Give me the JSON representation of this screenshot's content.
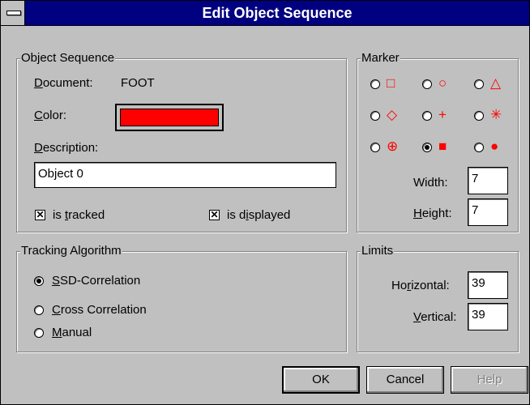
{
  "window": {
    "title": "Edit Object Sequence"
  },
  "object_sequence": {
    "group_label": "Object Sequence",
    "document_label": "Document:",
    "document_value": "FOOT",
    "color_label": "Color:",
    "color_value": "#ff0000",
    "description_label": "Description:",
    "description_value": "Object 0",
    "is_tracked_label": "is tracked",
    "is_tracked_checked": true,
    "is_displayed_label": "is displayed",
    "is_displayed_checked": true,
    "check_mark": "✕"
  },
  "marker": {
    "group_label": "Marker",
    "options": [
      {
        "symbol": "□",
        "shape": "hollow-square",
        "selected": false
      },
      {
        "symbol": "○",
        "shape": "hollow-circle",
        "selected": false
      },
      {
        "symbol": "△",
        "shape": "hollow-triangle",
        "selected": false
      },
      {
        "symbol": "◇",
        "shape": "hollow-diamond",
        "selected": false
      },
      {
        "symbol": "+",
        "shape": "plus",
        "selected": false
      },
      {
        "symbol": "✳",
        "shape": "asterisk",
        "selected": false
      },
      {
        "symbol": "⊕",
        "shape": "circled-plus",
        "selected": false
      },
      {
        "symbol": "■",
        "shape": "filled-square",
        "selected": true
      },
      {
        "symbol": "●",
        "shape": "filled-circle",
        "selected": false
      }
    ],
    "width_label": "Width:",
    "width_value": "7",
    "height_label": "Height:",
    "height_value": "7"
  },
  "tracking": {
    "group_label": "Tracking Algorithm",
    "options": [
      {
        "label": "SSD-Correlation",
        "selected": true
      },
      {
        "label": "Cross Correlation",
        "selected": false
      },
      {
        "label": "Manual",
        "selected": false
      }
    ]
  },
  "limits": {
    "group_label": "Limits",
    "horizontal_label": "Horizontal:",
    "horizontal_value": "39",
    "vertical_label": "Vertical:",
    "vertical_value": "39"
  },
  "buttons": {
    "ok": "OK",
    "cancel": "Cancel",
    "help": "Help"
  },
  "colors": {
    "title_bar": "#000080",
    "face": "#c0c0c0",
    "marker": "#ff0000"
  }
}
